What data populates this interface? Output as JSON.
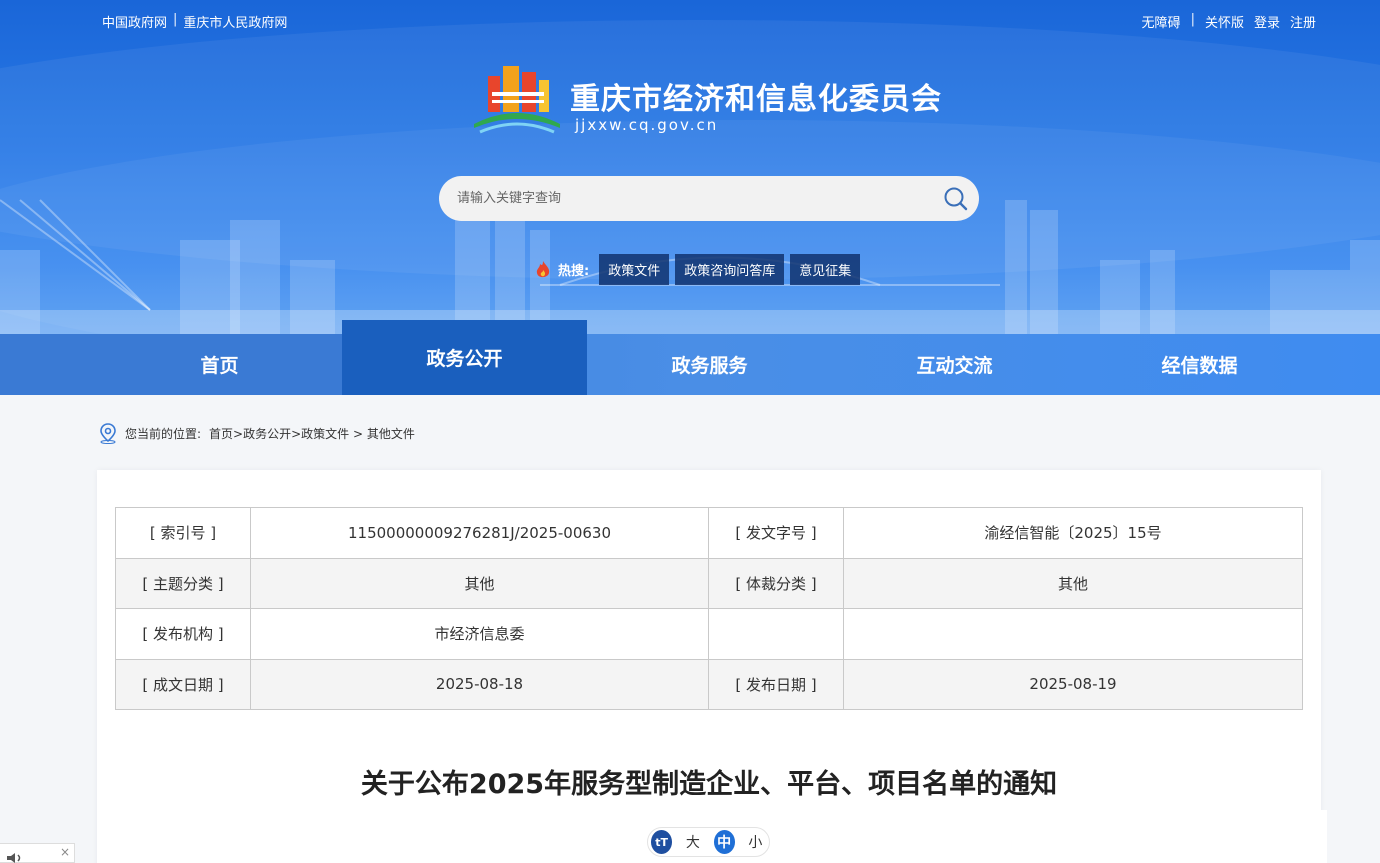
{
  "top_links_left": [
    "中国政府网",
    "重庆市人民政府网"
  ],
  "top_links_right": [
    "无障碍",
    "关怀版",
    "登录",
    "注册"
  ],
  "site": {
    "title": "重庆市经济和信息化委员会",
    "domain": "jjxxw.cq.gov.cn"
  },
  "search": {
    "placeholder": "请输入关键字查询"
  },
  "hot": {
    "label": "热搜:",
    "tags": [
      "政策文件",
      "政策咨询问答库",
      "意见征集"
    ]
  },
  "nav": {
    "items": [
      "首页",
      "政务公开",
      "政务服务",
      "互动交流",
      "经信数据"
    ],
    "active": "政务公开"
  },
  "breadcrumb": {
    "prefix": "您当前的位置:",
    "path": "首页>政务公开>政策文件 > 其他文件"
  },
  "meta_table": {
    "rows": [
      [
        "[ 索引号 ]",
        "11500000009276281J/2025-00630",
        "[ 发文字号 ]",
        "渝经信智能〔2025〕15号"
      ],
      [
        "[ 主题分类 ]",
        "其他",
        "[ 体裁分类 ]",
        "其他"
      ],
      [
        "[ 发布机构 ]",
        "市经济信息委",
        "",
        ""
      ],
      [
        "[ 成文日期 ]",
        "2025-08-18",
        "[ 发布日期 ]",
        "2025-08-19"
      ]
    ]
  },
  "document": {
    "title": "关于公布2025年服务型制造企业、平台、项目名单的通知"
  },
  "font_size": {
    "icon_label": "tT",
    "options": [
      "大",
      "中",
      "小"
    ],
    "selected": "中"
  },
  "colors": {
    "header_blue": "#2a7ae6",
    "nav_active": "#1a5fbe",
    "hot_tag_bg": "#10326e"
  }
}
